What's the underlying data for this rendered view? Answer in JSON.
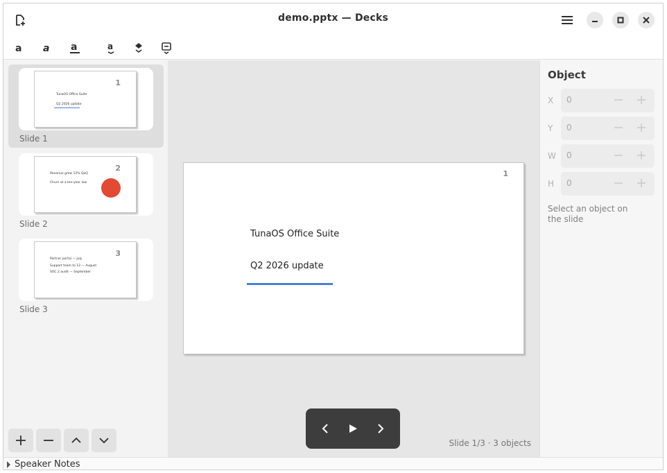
{
  "window": {
    "title": "demo.pptx — Decks"
  },
  "toolbar": {
    "buttons": [
      "bold-icon",
      "italic-icon",
      "underline-icon",
      "text-color-icon",
      "fill-color-icon",
      "comment-icon"
    ]
  },
  "slides_panel": {
    "slides": [
      {
        "number": "1",
        "caption": "Slide 1",
        "lines": [
          "TunaOS Office Suite",
          "Q2 2026 update"
        ],
        "selected": true
      },
      {
        "number": "2",
        "caption": "Slide 2",
        "lines": [
          "Revenue grew 12% QoQ",
          "Churn at a ten-year low"
        ],
        "has_circle": true
      },
      {
        "number": "3",
        "caption": "Slide 3",
        "lines": [
          "Partner portal — July",
          "Support team to 12 — August",
          "SOC 2 audit — September"
        ]
      }
    ],
    "buttons": [
      "add-icon",
      "remove-icon",
      "move-up-icon",
      "move-down-icon"
    ]
  },
  "canvas": {
    "slide_number": "1",
    "title_text": "TunaOS Office Suite",
    "subtitle_text": "Q2 2026 update",
    "accent_color": "#4a80d6",
    "status": "Slide 1/3 · 3 objects"
  },
  "inspector": {
    "title": "Object",
    "fields": [
      {
        "label": "X",
        "value": "0"
      },
      {
        "label": "Y",
        "value": "0"
      },
      {
        "label": "W",
        "value": "0"
      },
      {
        "label": "H",
        "value": "0"
      }
    ],
    "hint": "Select an object on the slide"
  },
  "notes": {
    "label": "Speaker Notes"
  },
  "colors": {
    "circle": "#e34a33",
    "playbar": "#3d3d3d"
  }
}
